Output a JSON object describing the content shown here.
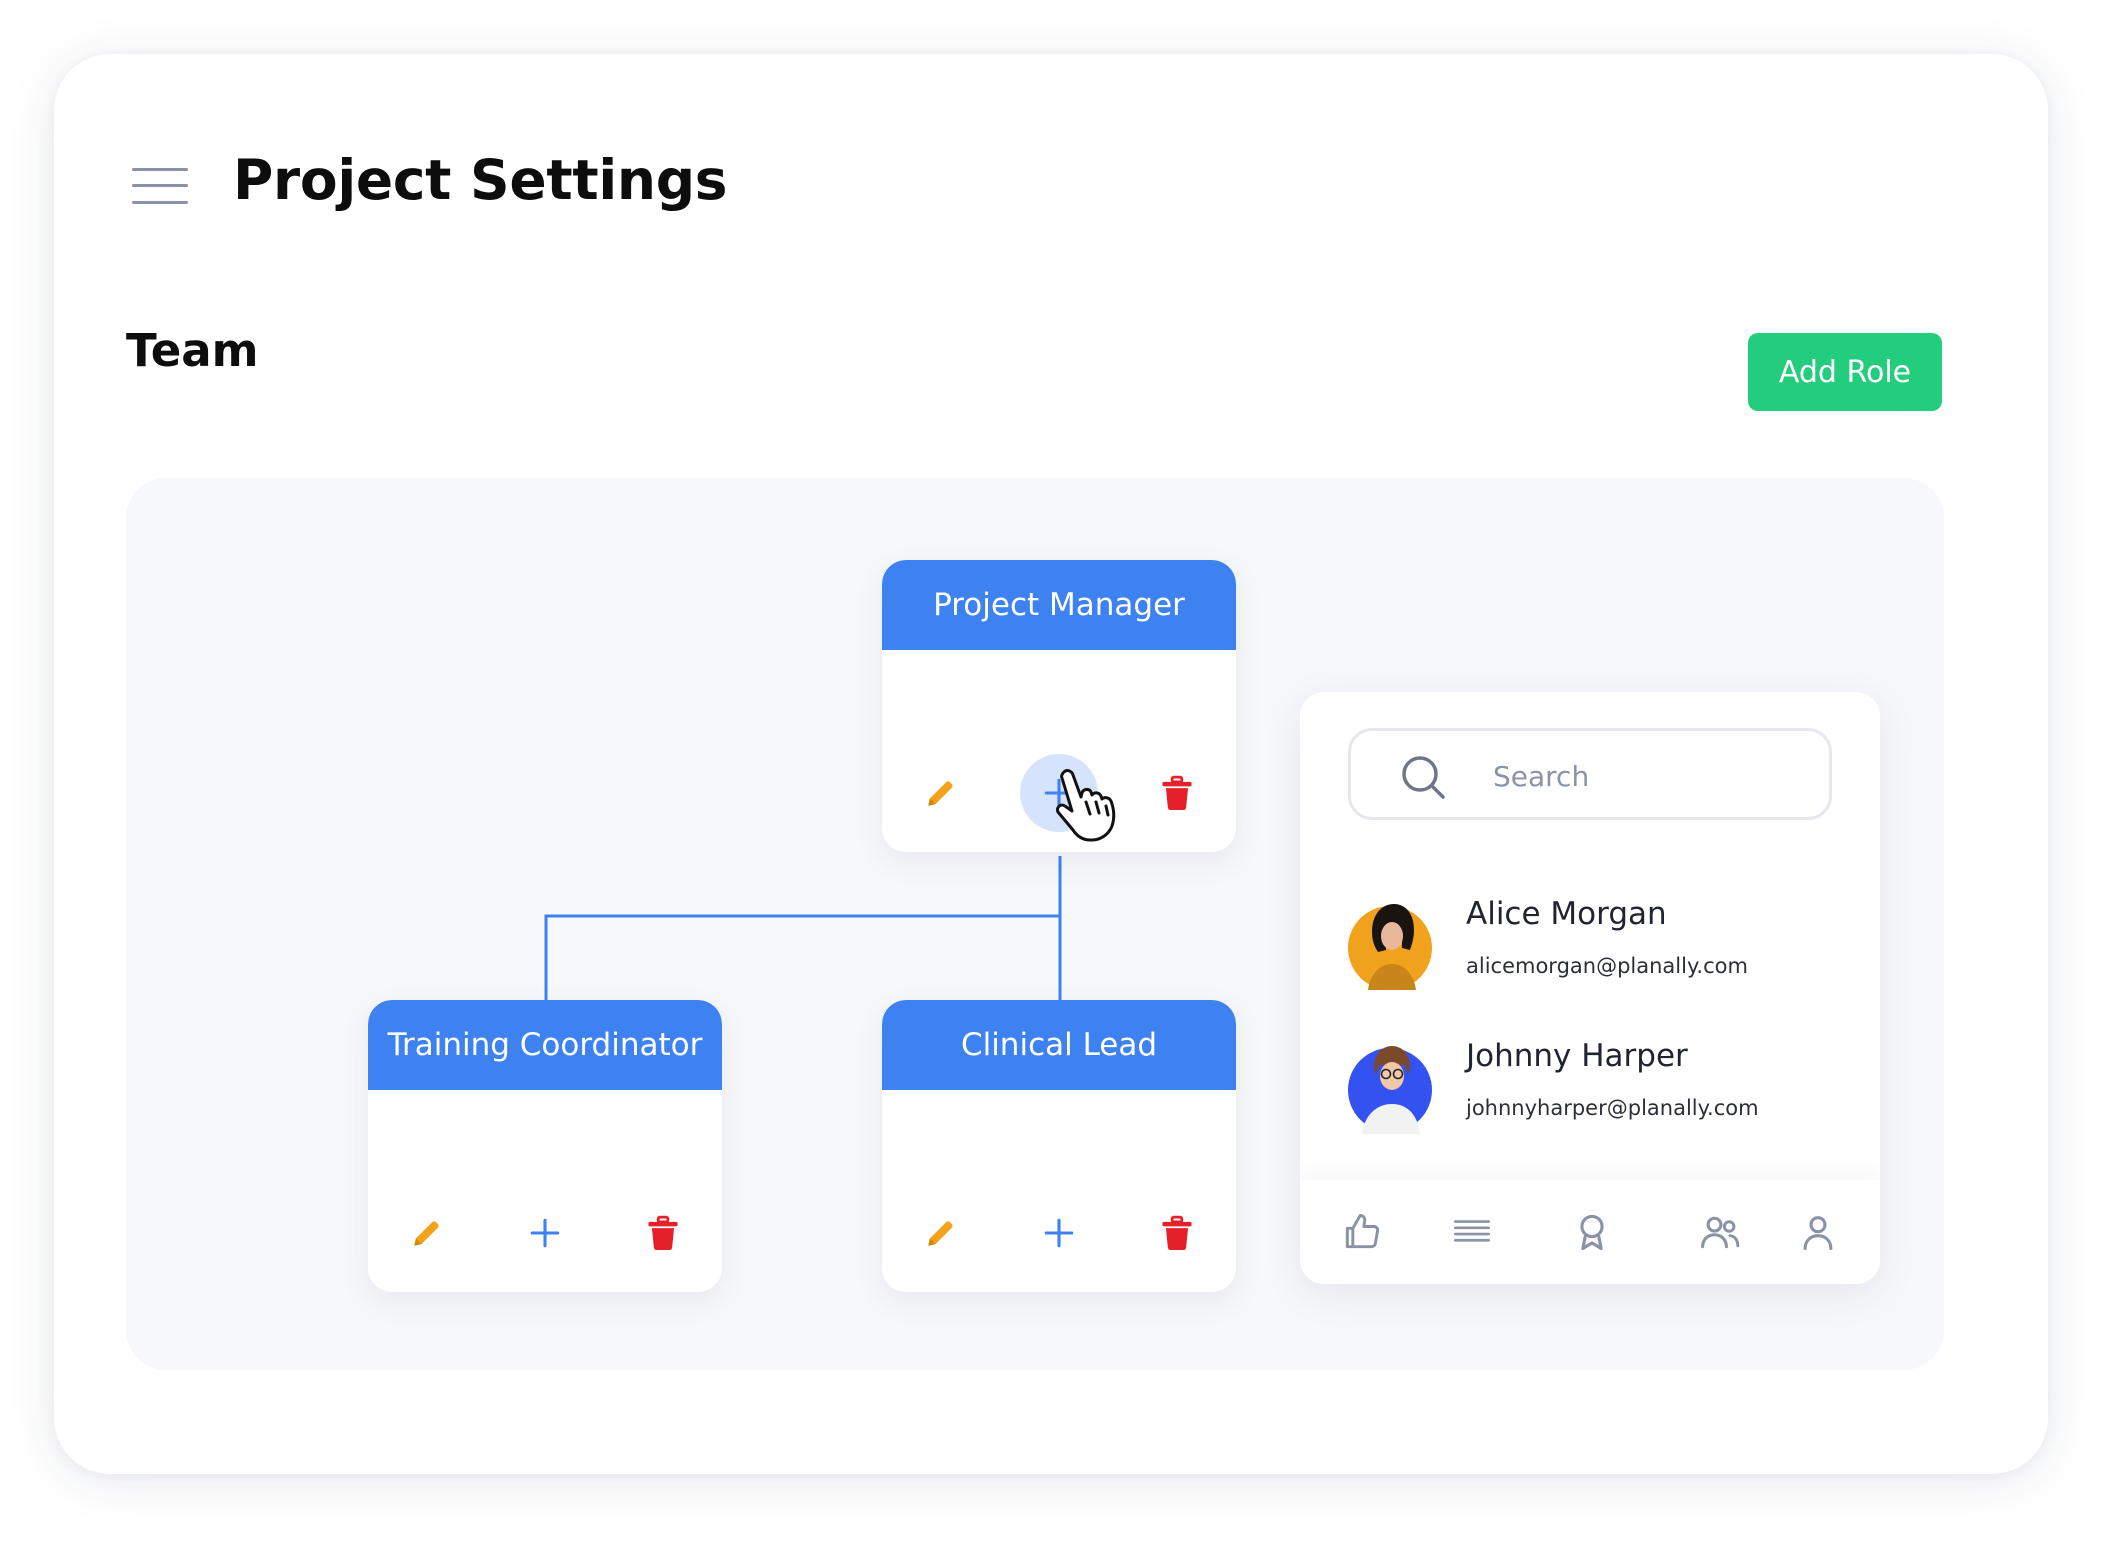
{
  "header": {
    "title": "Project Settings"
  },
  "team": {
    "section_title": "Team",
    "add_role_label": "Add Role"
  },
  "roles": [
    {
      "title": "Project Manager"
    },
    {
      "title": "Training Coordinator"
    },
    {
      "title": "Clinical Lead"
    }
  ],
  "members_panel": {
    "search_placeholder": "Search",
    "members": [
      {
        "name": "Alice Morgan",
        "email": "alicemorgan@planally.com",
        "avatar_color": "#f0a21c"
      },
      {
        "name": "Johnny Harper",
        "email": "johnnyharper@planally.com",
        "avatar_color": "#3452f0"
      }
    ],
    "nav_icons": [
      "thumbs-up-icon",
      "list-icon",
      "award-icon",
      "users-icon",
      "user-icon"
    ]
  },
  "colors": {
    "accent": "#3e82f1",
    "add_role": "#23cd7d",
    "edit": "#f3a21b",
    "delete": "#e62028",
    "icon_gray": "#8a93a6"
  }
}
